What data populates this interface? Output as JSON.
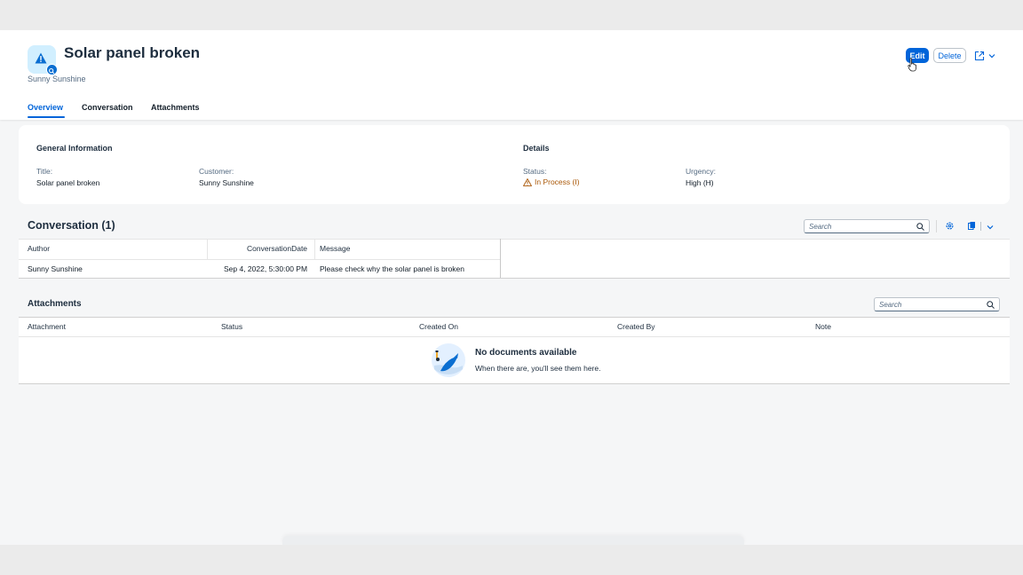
{
  "header": {
    "title": "Solar panel broken",
    "subtitle": "Sunny Sunshine",
    "edit_label": "Edit",
    "delete_label": "Delete"
  },
  "tabs": [
    {
      "label": "Overview",
      "active": true
    },
    {
      "label": "Conversation",
      "active": false
    },
    {
      "label": "Attachments",
      "active": false
    }
  ],
  "general": {
    "section_title": "General Information",
    "title_label": "Title:",
    "title_value": "Solar panel broken",
    "customer_label": "Customer:",
    "customer_value": "Sunny Sunshine"
  },
  "details": {
    "section_title": "Details",
    "status_label": "Status:",
    "status_value": "In Process (I)",
    "urgency_label": "Urgency:",
    "urgency_value": "High (H)"
  },
  "conversation": {
    "title": "Conversation (1)",
    "search_placeholder": "Search",
    "columns": [
      "Author",
      "ConversationDate",
      "Message"
    ],
    "rows": [
      {
        "author": "Sunny Sunshine",
        "date": "Sep 4, 2022, 5:30:00 PM",
        "message": "Please check why the solar panel is broken"
      }
    ]
  },
  "attachments": {
    "title": "Attachments",
    "search_placeholder": "Search",
    "columns": [
      "Attachment",
      "Status",
      "Created On",
      "Created By",
      "Note"
    ],
    "empty_title": "No documents available",
    "empty_subtitle": "When there are, you'll see them here."
  },
  "colors": {
    "accent": "#0064d9",
    "status_warning": "#aa5808",
    "avatar_bg": "#d1efff"
  },
  "icons": [
    "warning-icon",
    "search-icon",
    "settings-icon",
    "export-icon",
    "share-icon",
    "chevron-down-icon"
  ]
}
